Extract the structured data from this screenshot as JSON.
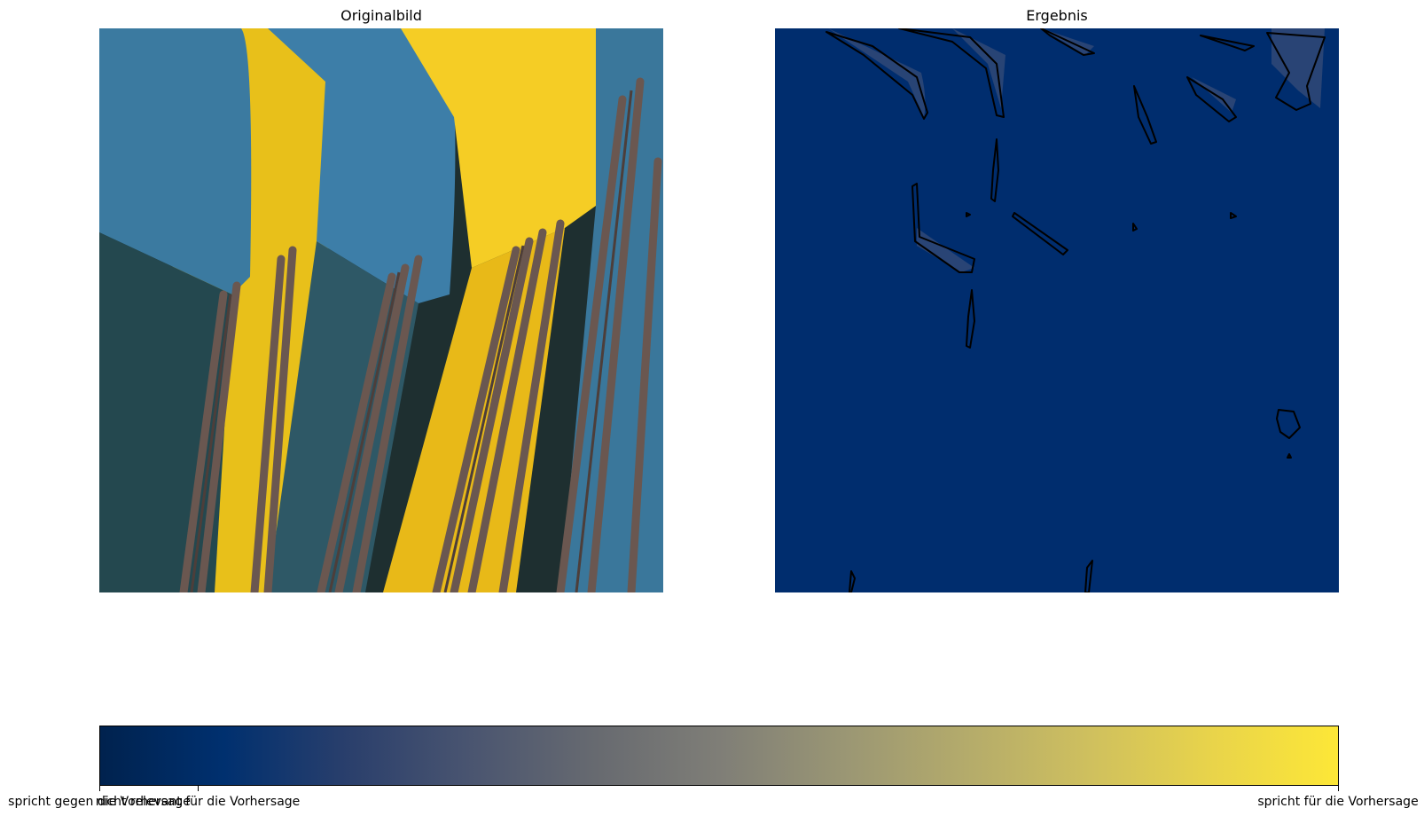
{
  "panels": {
    "left_title": "Originalbild",
    "right_title": "Ergebnis"
  },
  "colorbar": {
    "colormap": "cividis",
    "colors": {
      "low": "#00224e",
      "low_mid": "#00306f",
      "mid_low": "#3d4d6e",
      "mid": "#7c7b78",
      "mid_high": "#b4a86e",
      "high": "#fde737"
    },
    "tick_labels": [
      "spricht gegen die Vorhersage",
      "nicht relevant für die Vorhersage",
      "spricht für die Vorhersage"
    ]
  },
  "image_colors": {
    "chair_blue": "#3a7ca5",
    "chair_yellow": "#f3c81b",
    "frame_brown": "#6e5a50",
    "heatmap_background": "#002d6e"
  }
}
